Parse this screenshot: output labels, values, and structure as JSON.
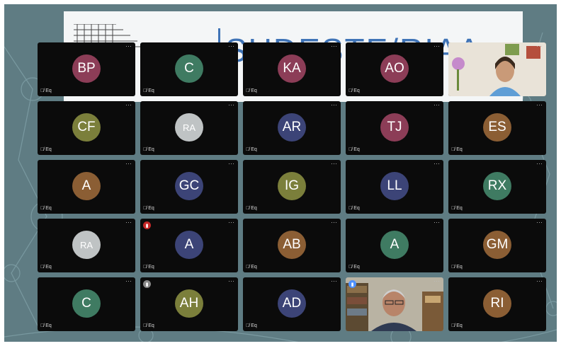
{
  "banner": {
    "title": "SUDESTE/RIAA"
  },
  "participants": [
    {
      "initials": "BP",
      "color": "#8c3d57",
      "kind": "avatar",
      "mic": "🎙̸ Eq",
      "speaking": null
    },
    {
      "initials": "C",
      "color": "#3f7b62",
      "kind": "avatar",
      "mic": "🎙̸ Eq",
      "speaking": null
    },
    {
      "initials": "KA",
      "color": "#8c3d57",
      "kind": "avatar",
      "mic": "🎙̸ Eq",
      "speaking": null
    },
    {
      "initials": "AO",
      "color": "#8c3d57",
      "kind": "avatar",
      "mic": "🎙̸ Eq",
      "speaking": null
    },
    {
      "initials": "",
      "color": "",
      "kind": "video-woman",
      "mic": "",
      "speaking": null
    },
    {
      "initials": "CF",
      "color": "#7b7f3b",
      "kind": "avatar",
      "mic": "🎙̸ Eq",
      "speaking": null
    },
    {
      "initials": "RA",
      "color": "#bfc3c4",
      "kind": "photo",
      "mic": "🎙̸ Eq",
      "speaking": null
    },
    {
      "initials": "AR",
      "color": "#3c4477",
      "kind": "avatar",
      "mic": "🎙̸ Eq",
      "speaking": null
    },
    {
      "initials": "TJ",
      "color": "#8c3d57",
      "kind": "avatar",
      "mic": "🎙̸ Eq",
      "speaking": null
    },
    {
      "initials": "ES",
      "color": "#8b5e34",
      "kind": "avatar",
      "mic": "🎙̸ Eq",
      "speaking": null
    },
    {
      "initials": "A",
      "color": "#8b5e34",
      "kind": "avatar",
      "mic": "🎙̸ Eq",
      "speaking": null
    },
    {
      "initials": "GC",
      "color": "#3c4477",
      "kind": "avatar",
      "mic": "🎙̸ Eq",
      "speaking": null
    },
    {
      "initials": "IG",
      "color": "#7b7f3b",
      "kind": "avatar",
      "mic": "🎙̸ Eq",
      "speaking": null
    },
    {
      "initials": "LL",
      "color": "#3c4477",
      "kind": "avatar",
      "mic": "🎙̸ Eq",
      "speaking": null
    },
    {
      "initials": "RX",
      "color": "#3f7b62",
      "kind": "avatar",
      "mic": "🎙̸ Eq",
      "speaking": null
    },
    {
      "initials": "RA",
      "color": "#bfc3c4",
      "kind": "photo",
      "mic": "🎙̸ Eq",
      "speaking": null
    },
    {
      "initials": "A",
      "color": "#3c4477",
      "kind": "avatar",
      "mic": "🎙̸ Eq",
      "speaking": "#c62828"
    },
    {
      "initials": "AB",
      "color": "#8b5e34",
      "kind": "avatar",
      "mic": "🎙̸ Eq",
      "speaking": null
    },
    {
      "initials": "A",
      "color": "#3f7b62",
      "kind": "avatar",
      "mic": "🎙̸ Eq",
      "speaking": null
    },
    {
      "initials": "GM",
      "color": "#8b5e34",
      "kind": "avatar",
      "mic": "🎙̸ Eq",
      "speaking": null
    },
    {
      "initials": "C",
      "color": "#3f7b62",
      "kind": "avatar",
      "mic": "🎙̸ Eq",
      "speaking": null
    },
    {
      "initials": "AH",
      "color": "#7b7f3b",
      "kind": "avatar",
      "mic": "🎙̸ Eq",
      "speaking": "#888888"
    },
    {
      "initials": "AD",
      "color": "#3c4477",
      "kind": "avatar",
      "mic": "🎙̸ Eq",
      "speaking": null
    },
    {
      "initials": "",
      "color": "",
      "kind": "video-man",
      "mic": "",
      "speaking": "#4d90fe"
    },
    {
      "initials": "RI",
      "color": "#8b5e34",
      "kind": "avatar",
      "mic": "🎙̸ Eq",
      "speaking": null
    }
  ],
  "tile_menu_glyph": "···",
  "mic_icon": "mic-off-icon"
}
